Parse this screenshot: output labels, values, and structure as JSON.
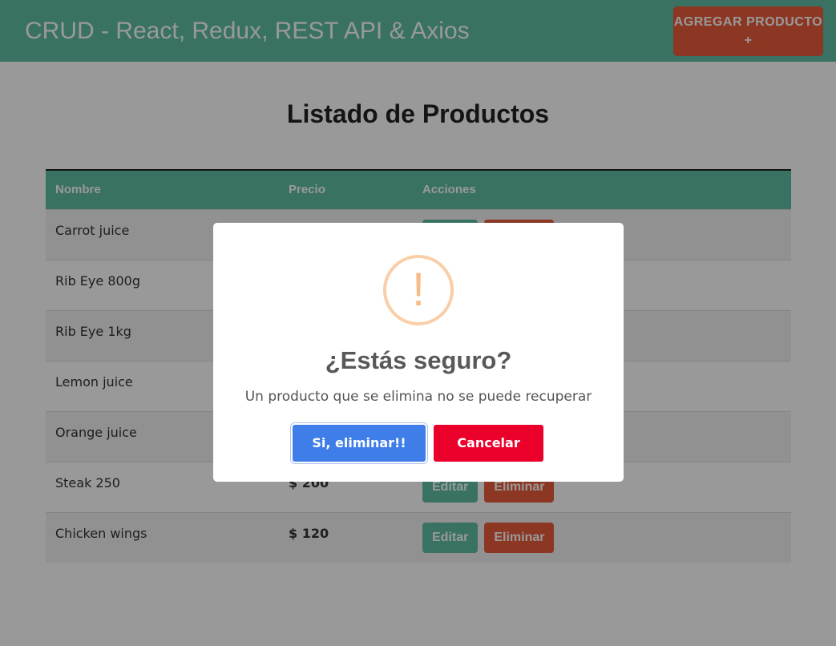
{
  "navbar": {
    "brand": "CRUD - React, Redux, REST API & Axios",
    "add_button": "AGREGAR PRODUCTO +"
  },
  "page": {
    "title": "Listado de Productos"
  },
  "table": {
    "headers": [
      "Nombre",
      "Precio",
      "Acciones"
    ],
    "rows": [
      {
        "name": "Carrot juice",
        "price": ""
      },
      {
        "name": "Rib Eye 800g",
        "price": ""
      },
      {
        "name": "Rib Eye 1kg",
        "price": ""
      },
      {
        "name": "Lemon juice",
        "price": ""
      },
      {
        "name": "Orange juice",
        "price": ""
      },
      {
        "name": "Steak 250",
        "price": "$ 200"
      },
      {
        "name": "Chicken wings",
        "price": "$ 120"
      }
    ],
    "edit_label": "Editar",
    "delete_label": "Eliminar"
  },
  "modal": {
    "icon": "!",
    "title": "¿Estás seguro?",
    "text": "Un producto que se elimina no se puede recuperar",
    "confirm": "Si, eliminar!!",
    "cancel": "Cancelar"
  },
  "colors": {
    "primary": "#5fbfa4",
    "danger": "#e95c3d",
    "confirm": "#3f7ee8",
    "cancel": "#ea002a",
    "warning": "#f8bb86"
  }
}
